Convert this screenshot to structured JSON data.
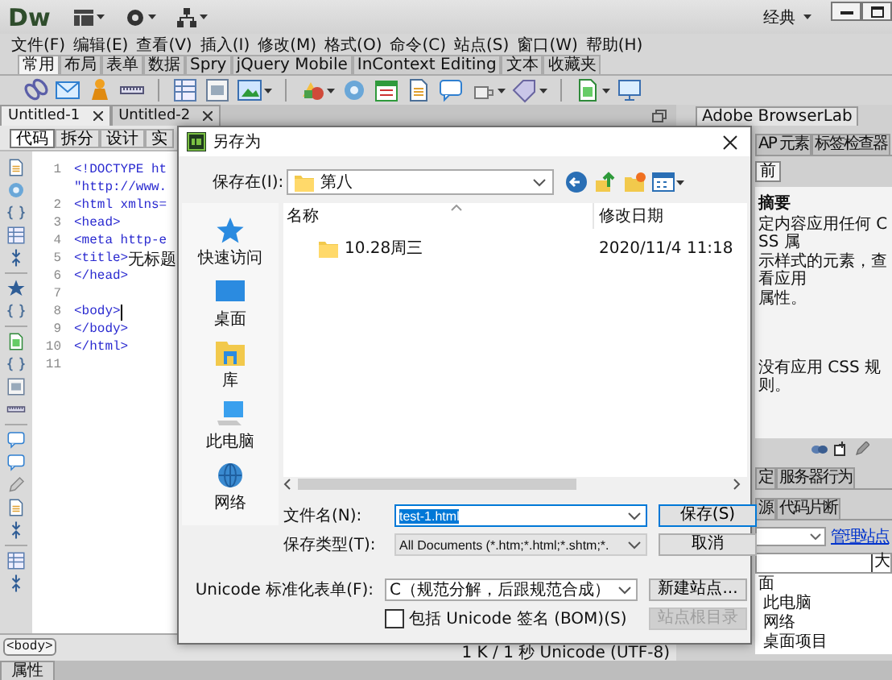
{
  "app": {
    "logo": "Dw",
    "workspace": "经典"
  },
  "menu": [
    "文件(F)",
    "编辑(E)",
    "查看(V)",
    "插入(I)",
    "修改(M)",
    "格式(O)",
    "命令(C)",
    "站点(S)",
    "窗口(W)",
    "帮助(H)"
  ],
  "insert_tabs": [
    {
      "label": "常用",
      "selected": true
    },
    {
      "label": "布局",
      "selected": false
    },
    {
      "label": "表单",
      "selected": false
    },
    {
      "label": "数据",
      "selected": false
    },
    {
      "label": "Spry",
      "selected": false
    },
    {
      "label": "jQuery Mobile",
      "selected": false
    },
    {
      "label": "InContext Editing",
      "selected": false
    },
    {
      "label": "文本",
      "selected": false
    },
    {
      "label": "收藏夹",
      "selected": false
    }
  ],
  "documents": [
    {
      "label": "Untitled-1",
      "selected": true
    },
    {
      "label": "Untitled-2",
      "selected": false
    }
  ],
  "view_buttons": [
    {
      "label": "代码",
      "selected": true
    },
    {
      "label": "拆分",
      "selected": false
    },
    {
      "label": "设计",
      "selected": false
    },
    {
      "label": "实",
      "selected": false
    }
  ],
  "code_lines": [
    {
      "number": "1",
      "parts": [
        {
          "kind": "tag",
          "text": "<!DOCTYPE ht"
        }
      ],
      "cursor": false
    },
    {
      "parts": [
        {
          "kind": "tag",
          "text": "\"http://www."
        }
      ],
      "cursor": false
    },
    {
      "number": "2",
      "parts": [
        {
          "kind": "tag",
          "text": "<html xmlns="
        }
      ],
      "cursor": false
    },
    {
      "number": "3",
      "parts": [
        {
          "kind": "tag",
          "text": "<head>"
        }
      ],
      "cursor": false
    },
    {
      "number": "4",
      "parts": [
        {
          "kind": "tag",
          "text": "<meta http-e"
        }
      ],
      "cursor": false
    },
    {
      "number": "5",
      "parts": [
        {
          "kind": "tag",
          "text": "<title>"
        },
        {
          "kind": "text",
          "text": "无标题"
        }
      ],
      "cursor": false
    },
    {
      "number": "6",
      "parts": [
        {
          "kind": "tag",
          "text": "</head>"
        }
      ],
      "cursor": false
    },
    {
      "number": "7",
      "cursor": false
    },
    {
      "number": "8",
      "parts": [
        {
          "kind": "tag",
          "text": "<body>"
        }
      ],
      "cursor": true
    },
    {
      "number": "9",
      "parts": [
        {
          "kind": "tag",
          "text": "</body>"
        }
      ],
      "cursor": false
    },
    {
      "number": "10",
      "parts": [
        {
          "kind": "tag",
          "text": "</html>"
        }
      ],
      "cursor": false
    },
    {
      "number": "11",
      "cursor": false
    }
  ],
  "status_bar": {
    "tag": "<body>",
    "info": "1 K / 1 秒 Unicode (UTF-8)"
  },
  "bottom_panel": {
    "tab": "属性"
  },
  "right_panel": {
    "top_tab": "Adobe BrowserLab",
    "tabs": [
      {
        "label": "AP 元素",
        "selected": false
      },
      {
        "label": "标签检查器",
        "selected": false
      }
    ],
    "mode_button": "前",
    "summary_title": "摘要",
    "summary_lines": [
      "定内容应用任何 CSS 属",
      "示样式的元素，查看应用",
      "属性。"
    ],
    "rules_text": "没有应用 CSS 规则。",
    "tabs_2": [
      {
        "label": "定",
        "selected": false
      },
      {
        "label": "服务器行为",
        "selected": false
      }
    ],
    "tabs_3": [
      {
        "label": "源",
        "selected": false
      },
      {
        "label": "代码片断",
        "selected": false
      }
    ],
    "manage_link": "管理站点",
    "column": "大",
    "tree": [
      {
        "label": "面",
        "children": [
          {
            "label": "此电脑"
          },
          {
            "label": "网络"
          },
          {
            "label": "桌面项目"
          }
        ]
      }
    ]
  },
  "dialog": {
    "title": "另存为",
    "save_in": {
      "label": "保存在(I):",
      "value": "第八"
    },
    "places": [
      {
        "label": "快速访问",
        "kind": "star"
      },
      {
        "label": "桌面",
        "kind": "desktop"
      },
      {
        "label": "库",
        "kind": "library"
      },
      {
        "label": "此电脑",
        "kind": "computer"
      },
      {
        "label": "网络",
        "kind": "network"
      }
    ],
    "columns": [
      "名称",
      "修改日期"
    ],
    "files": [
      {
        "name": "10.28周三",
        "date": "2020/11/4 11:18"
      }
    ],
    "file_name": {
      "label": "文件名(N):",
      "value": "test-1.html",
      "value_selected": true
    },
    "file_type": {
      "label": "保存类型(T):",
      "value": "All Documents (*.htm;*.html;*.shtm;*."
    },
    "unicode_form": {
      "label": "Unicode 标准化表单(F):",
      "value": "C（规范分解，后跟规范合成）"
    },
    "bom_checkbox": {
      "label": "包括 Unicode 签名 (BOM)(S)",
      "checked": false
    },
    "buttons": [
      {
        "label": "保存(S)",
        "primary": true,
        "disabled": false
      },
      {
        "label": "取消",
        "primary": false,
        "disabled": false
      },
      {
        "label": "新建站点...",
        "primary": false,
        "disabled": false
      },
      {
        "label": "站点根目录",
        "primary": false,
        "disabled": true
      }
    ]
  }
}
